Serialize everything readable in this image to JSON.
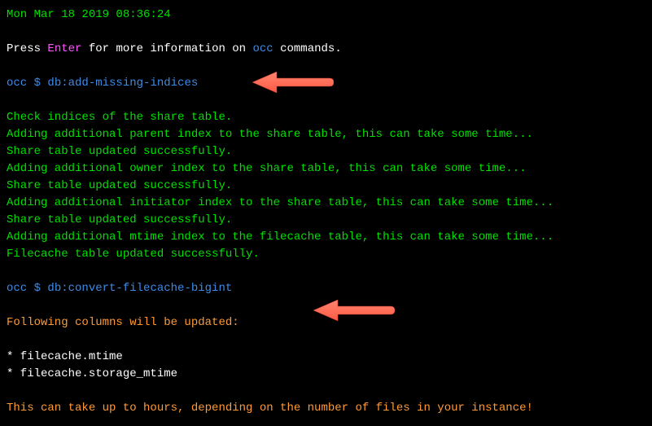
{
  "timestamp": "Mon Mar 18 2019 08:36:24",
  "intro": {
    "press": "Press ",
    "enter": "Enter",
    "mid": " for more information on ",
    "occ": "occ",
    "tail": " commands."
  },
  "prompt1": {
    "prefix": "occ $ ",
    "cmd": "db:add-missing-indices"
  },
  "output1": [
    "Check indices of the share table.",
    "Adding additional parent index to the share table, this can take some time...",
    "Share table updated successfully.",
    "Adding additional owner index to the share table, this can take some time...",
    "Share table updated successfully.",
    "Adding additional initiator index to the share table, this can take some time...",
    "Share table updated successfully.",
    "Adding additional mtime index to the filecache table, this can take some time...",
    "Filecache table updated successfully."
  ],
  "prompt2": {
    "prefix": "occ $ ",
    "cmd": "db:convert-filecache-bigint"
  },
  "output2": {
    "header": "Following columns will be updated:",
    "items": [
      "* filecache.mtime",
      "* filecache.storage_mtime"
    ],
    "warn": "This can take up to hours, depending on the number of files in your instance!"
  }
}
